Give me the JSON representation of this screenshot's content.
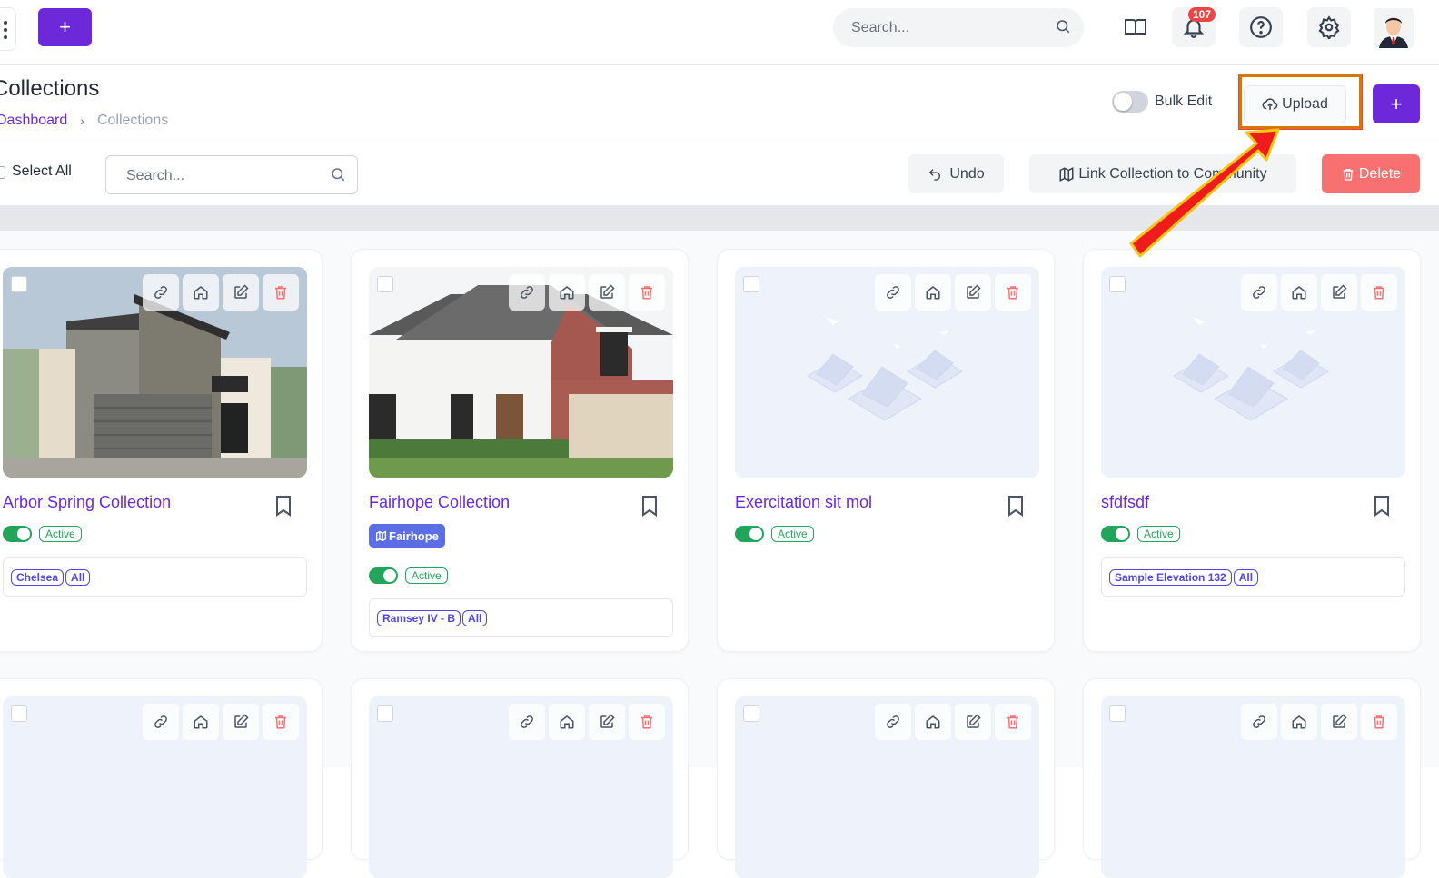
{
  "topbar": {
    "add_label": "+",
    "search_placeholder": "Search...",
    "notification_count": "107"
  },
  "header": {
    "title": "Collections",
    "breadcrumb": {
      "parent": "Dashboard",
      "current": "Collections"
    },
    "bulk_edit_label": "Bulk Edit",
    "upload_label": "Upload",
    "add_label": "+"
  },
  "toolbar": {
    "select_all_label": "Select All",
    "search_placeholder": "Search...",
    "undo_label": "Undo",
    "link_label": "Link Collection to Community",
    "delete_label": "Delete"
  },
  "cards": [
    {
      "title": "Arbor Spring Collection",
      "status": "Active",
      "tags": [
        "Chelsea",
        "All"
      ],
      "image": "modern-house"
    },
    {
      "title": "Fairhope Collection",
      "community": "Fairhope",
      "status": "Active",
      "tags": [
        "Ramsey IV - B",
        "All"
      ],
      "image": "brick-house"
    },
    {
      "title": "Exercitation sit mol",
      "status": "Active",
      "tags": [],
      "image": "placeholder"
    },
    {
      "title": "sfdfsdf",
      "status": "Active",
      "tags": [
        "Sample Elevation 132",
        "All"
      ],
      "image": "placeholder"
    }
  ],
  "colors": {
    "accent": "#6d28d9",
    "active_green": "#22a55b",
    "delete_red": "#f87171",
    "tag_blue": "#4f46e5"
  }
}
